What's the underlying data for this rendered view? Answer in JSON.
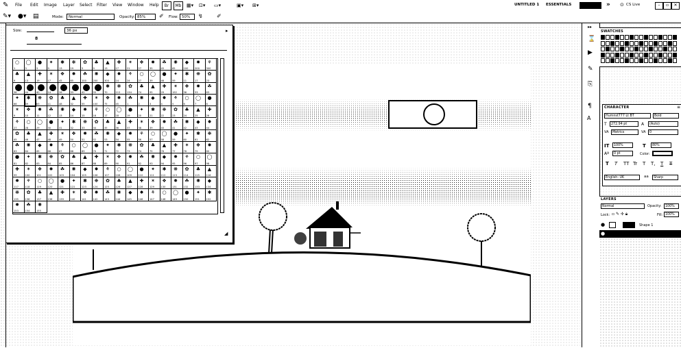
{
  "menubar": {
    "items": [
      "File",
      "Edit",
      "Image",
      "Layer",
      "Select",
      "Filter",
      "View",
      "Window",
      "Help"
    ],
    "doc_title": "UNTITLED 1",
    "workspace": "ESSENTIALS",
    "search": "CS Live"
  },
  "options": {
    "mode_label": "Mode:",
    "mode_value": "Normal",
    "opacity_label": "Opacity:",
    "opacity_value": "85%",
    "flow_label": "Flow:",
    "flow_value": "50%"
  },
  "brush_picker": {
    "size_label": "Size:",
    "size_value": "36 px",
    "hardness_value": "8",
    "rows": [
      [
        "1",
        "3",
        "5",
        "9",
        "13",
        "19",
        "5",
        "9",
        "13",
        "17",
        "21",
        "27",
        "35",
        "45",
        "65",
        "100",
        "200",
        "300"
      ],
      [
        "9",
        "13",
        "19",
        "17",
        "45",
        "65",
        "100",
        "200",
        "300",
        "14",
        "24",
        "27",
        "39",
        "46",
        "59",
        "11",
        "17",
        "23"
      ],
      [
        "36",
        "44",
        "60",
        "14",
        "26",
        "33",
        "42",
        "55",
        "70",
        "112",
        "134",
        "74",
        "95",
        "29",
        "192",
        "36",
        "33",
        "63"
      ],
      [
        "66",
        "39",
        "63",
        "11",
        "48",
        "32",
        "55",
        "100",
        "75",
        "45",
        "1",
        "2",
        "3",
        "4",
        "5",
        "6",
        "7",
        "8"
      ],
      [
        "9",
        "10",
        "11",
        "12",
        "13",
        "14",
        "15",
        "16",
        "17",
        "18",
        "19",
        "20",
        "21",
        "22",
        "23",
        "24",
        "25",
        "26"
      ],
      [
        "27",
        "28",
        "29",
        "30",
        "31",
        "32",
        "33",
        "34",
        "35",
        "36",
        "37",
        "38",
        "39",
        "40",
        "41",
        "42",
        "43",
        "44"
      ],
      [
        "45",
        "46",
        "47",
        "48",
        "49",
        "50",
        "51",
        "52",
        "53",
        "54",
        "55",
        "56",
        "57",
        "58",
        "59",
        "60",
        "61",
        "62"
      ],
      [
        "63",
        "64",
        "65",
        "66",
        "67",
        "68",
        "69",
        "70",
        "71",
        "72",
        "73",
        "74",
        "75",
        "76",
        "77",
        "78",
        "79",
        "80"
      ],
      [
        "81",
        "82",
        "83",
        "84",
        "85",
        "86",
        "87",
        "88",
        "89",
        "90",
        "91",
        "92",
        "93",
        "94",
        "95",
        "96",
        "97",
        "98"
      ],
      [
        "99",
        "100",
        "101",
        "102",
        "103",
        "104",
        "105",
        "106",
        "107",
        "108",
        "109",
        "110",
        "111",
        "112",
        "113",
        "114",
        "115",
        "116"
      ],
      [
        "117",
        "118",
        "119",
        "120",
        "121",
        "122",
        "123",
        "124",
        "125",
        "126",
        "127",
        "128",
        "129",
        "130",
        "131",
        "132",
        "133",
        "134"
      ],
      [
        "135",
        "136",
        "137",
        "138",
        "139",
        "140",
        "141",
        "142",
        "143",
        "144",
        "145",
        "146",
        "147",
        "148",
        "149",
        "150",
        "151",
        "152"
      ],
      [
        "153",
        "154",
        "155"
      ]
    ],
    "selected_index": 2
  },
  "swatches": {
    "tab": "SWATCHES"
  },
  "character": {
    "tab": "CHARACTER",
    "font_family": "Humnst777 Lt BT",
    "font_style": "Bold",
    "font_size": "272.94 pt",
    "leading": "(Auto)",
    "kerning": "Metrics",
    "tracking": "0",
    "vscale": "100%",
    "hscale": "80%",
    "baseline": "0 pt",
    "color_label": "Color:",
    "styles": [
      "T",
      "T",
      "TT",
      "Tr",
      "T",
      "T,",
      "T",
      "T"
    ],
    "language": "English: UK",
    "aa_label": "aa",
    "antialias": "Sharp"
  },
  "layers": {
    "tab": "LAYERS",
    "blend": "Normal",
    "opacity_label": "Opacity:",
    "opacity": "100%",
    "lock_label": "Lock:",
    "fill_label": "Fill:",
    "fill": "100%",
    "items": [
      {
        "name": "Shape 1",
        "selected": false
      },
      {
        "name": "",
        "selected": true
      }
    ]
  }
}
